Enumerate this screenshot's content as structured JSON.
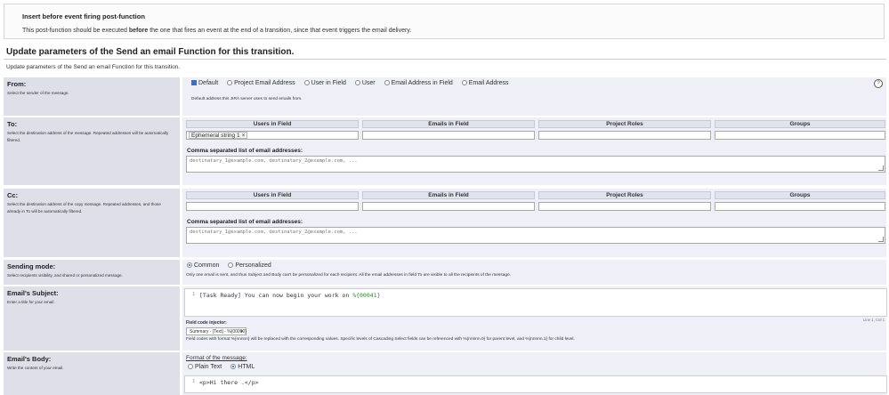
{
  "banner": {
    "title": "Insert before event firing post-function",
    "desc_pre": "This post-function should be executed ",
    "desc_bold": "before",
    "desc_post": " the one that fires an event at the end of a transition, since that event triggers the email delivery."
  },
  "page": {
    "title": "Update parameters of the Send an email Function for this transition.",
    "subtitle": "Update parameters of the Send an email Function for this transition."
  },
  "from": {
    "label": "From:",
    "desc": "Select the sender of the message.",
    "options": [
      "Default",
      "Project Email Address",
      "User in Field",
      "User",
      "Email Address in Field",
      "Email Address"
    ],
    "selected": "Default",
    "hint": "Default address this JIRA server uses to send emails from.",
    "help": "?"
  },
  "to": {
    "label": "To:",
    "desc": "Select the destination address of the message. Repeated addresses will be automatically filtered.",
    "columns": [
      "Users in Field",
      "Emails in Field",
      "Project Roles",
      "Groups"
    ],
    "users_tag": "Ephemeral string 1",
    "tag_remove": "×",
    "csv_label": "Comma separated list of email addresses:",
    "csv_placeholder": "destinatary_1@example.com, destinatary_2@example.com, ..."
  },
  "cc": {
    "label": "Cc:",
    "desc": "Select the destination address of the copy message. Repeated addresses, and those already in To will be automatically filtered.",
    "columns": [
      "Users in Field",
      "Emails in Field",
      "Project Roles",
      "Groups"
    ],
    "csv_label": "Comma separated list of email addresses:",
    "csv_placeholder": "destinatary_1@example.com, destinatary_2@example.com, ..."
  },
  "sending_mode": {
    "label": "Sending mode:",
    "desc": "Select recipients visibility, and shared or personalized message.",
    "options": [
      "Common",
      "Personalized"
    ],
    "selected": "Common",
    "hint": "Only one email is sent, and thus Subject and Body can't be personalized for each recipient. All the email addresses in field To are visible to all the recipients of the message."
  },
  "subject": {
    "label": "Email's Subject:",
    "desc": "Enter a title for your email.",
    "line_no": "1",
    "code_pre": "[Task Ready] You can now begin your work on ",
    "code_hl": "%{00041}",
    "cursor": "Line 1, Col 1",
    "injector_label": "Field code injector:",
    "injector_value": "Summary - [Text] - %{00000}",
    "injector_caret": "▾",
    "hint": "Field codes with format %{nnnnn} will be replaced with the corresponding values. Specific levels of Cascading Select fields can be referenced with %{nnnnn.0} for parent level, and %{nnnnn.1} for child level."
  },
  "body": {
    "label": "Email's Body:",
    "desc": "Write the content of your email.",
    "format_label": "Format of the message:",
    "options": [
      "Plain Text",
      "HTML"
    ],
    "selected": "HTML",
    "line_no": "1",
    "code": "<p>Hi there .</p>"
  }
}
